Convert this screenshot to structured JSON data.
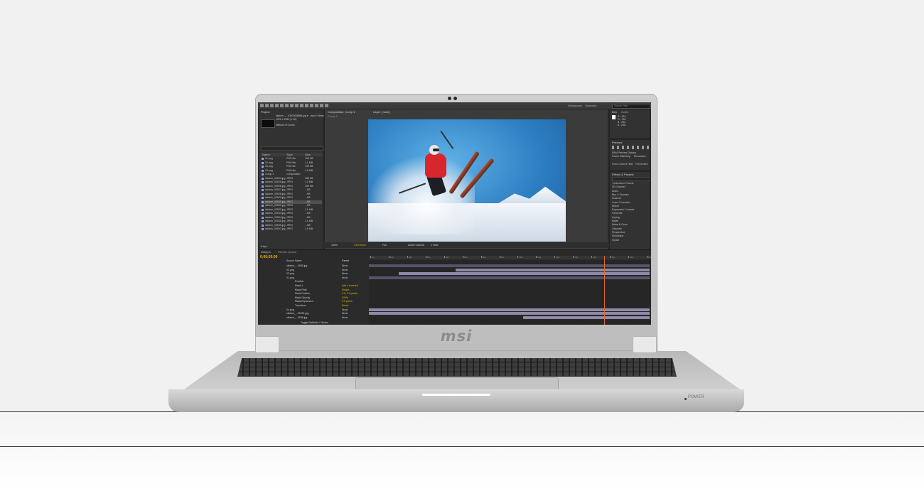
{
  "brand": {
    "logo_text": "msi",
    "power_label": "POWER"
  },
  "app": {
    "toolbar": {
      "workspace": "Workspace",
      "workspace_value": "Standard",
      "search_placeholder": "Search Help"
    },
    "project_panel": {
      "tab": "Project",
      "selected_item": "skier_stunt_00530.jpg",
      "meta_line_1": "skiahm — 100000(8888.jpg ▾ , used 1 time)",
      "meta_line_2": "1920 x 1080 (1.00)",
      "meta_line_3": "Millions of Colors",
      "columns": {
        "name": "Name",
        "type": "Type",
        "size": "Size"
      },
      "items": [
        {
          "name": "01.png",
          "type": "PNG file",
          "size": "765 KB"
        },
        {
          "name": "02.png",
          "type": "PNG file",
          "size": "1.1 MB"
        },
        {
          "name": "03.png",
          "type": "PNG file",
          "size": "735 KB"
        },
        {
          "name": "04.png",
          "type": "PNG file",
          "size": "1.0 MB"
        },
        {
          "name": "Comp 1",
          "type": "Composition",
          "size": ""
        },
        {
          "name": "skiahm_00524.jpg",
          "type": "JPEG",
          "size": "485 KB"
        },
        {
          "name": "skiahm_00525.jpg",
          "type": "JPEG",
          "size": "1.2 MB"
        },
        {
          "name": "skiahm_00526.jpg",
          "type": "JPEG",
          "size": "490 KB"
        },
        {
          "name": "skiahm_00527.jpg",
          "type": "JPEG",
          "size": "...KB"
        },
        {
          "name": "skiahm_00528.jpg",
          "type": "JPEG",
          "size": "...KB"
        },
        {
          "name": "skiahm_00529.jpg",
          "type": "JPEG",
          "size": "...KB"
        },
        {
          "name": "skiahm_00530.jpg",
          "type": "JPEG",
          "size": "...KB"
        },
        {
          "name": "skiahm_00531.jpg",
          "type": "JPEG",
          "size": "...KB"
        },
        {
          "name": "skiahm_00532.jpg",
          "type": "JPEG",
          "size": "1.1 MB"
        },
        {
          "name": "skiahm_00533.jpg",
          "type": "JPEG",
          "size": "...KB"
        },
        {
          "name": "skiahm_00534.jpg",
          "type": "JPEG",
          "size": "...KB"
        },
        {
          "name": "skiahm_00535.jpg",
          "type": "JPEG",
          "size": "1.1 MB"
        },
        {
          "name": "skiahm_00536.jpg",
          "type": "JPEG",
          "size": "...KB"
        },
        {
          "name": "skiahm_00537.jpg",
          "type": "JPEG",
          "size": "1.0 MB"
        }
      ],
      "footer": "8 bpc"
    },
    "composition_panel": {
      "tab_1": "Composition: Comp 1",
      "tab_2": "Layer: (none)",
      "sub_tab": "Comp 1",
      "zoom": "100%",
      "timecode": "0;00;00;00",
      "resolution": "Full",
      "camera": "Active Camera",
      "views": "1 View"
    },
    "right_panels": {
      "info_tab": "Info",
      "audio_tab": "Audio",
      "info_lines": [
        "R : 254",
        "G : 254",
        "B : 254",
        "A : 255"
      ],
      "preview_tab": "Preview",
      "preview_options": "RAM Preview Options",
      "frame_rate": "Frame Rate",
      "skip": "Skip",
      "resolution": "Resolution",
      "from_current": "From Current Time",
      "full_screen": "Full Screen",
      "effects_tab": "Effects & Presets",
      "effects": [
        "* Animation Presets",
        "3D Channel",
        "Audio",
        "Blur & Sharpen",
        "Channel",
        "Color Correction",
        "Distort",
        "Expression Controls",
        "Generate",
        "Keying",
        "Matte",
        "Noise & Grain",
        "Obsolete",
        "Perspective",
        "Simulation",
        "Stylize"
      ]
    },
    "timeline": {
      "tab": "Comp 1",
      "tab_2": "Render Queue",
      "timecode": "0;00;05;00",
      "columns": {
        "source": "Source Name",
        "parent": "Parent"
      },
      "layers": [
        {
          "name": "skiahm_...0530.jpg",
          "parent": "None"
        },
        {
          "name": "03.png",
          "parent": "None"
        },
        {
          "name": "02.png",
          "parent": "None"
        },
        {
          "name": "01.png",
          "parent": "None"
        },
        {
          "name": "Position",
          "parent": ""
        },
        {
          "name": "Mask 1",
          "parent": "Add ▾  Inverted"
        },
        {
          "name": "Mask Path",
          "parent": "Shape..."
        },
        {
          "name": "Mask Feather",
          "parent": "0.0, 0.0 pixels"
        },
        {
          "name": "Mask Opacity",
          "parent": "100%"
        },
        {
          "name": "Mask Expansion",
          "parent": "0.0 pixels"
        },
        {
          "name": "Transform",
          "parent": "Reset"
        },
        {
          "name": "04.png",
          "parent": "None"
        },
        {
          "name": "skiahm_...00531.jpg",
          "parent": "None"
        },
        {
          "name": "skiahm_...0536.jpg",
          "parent": "None"
        }
      ],
      "ruler_labels": [
        "0s",
        "01s",
        "02s",
        "03s",
        "04s",
        "05s",
        "06s",
        "07s",
        "08s",
        "09s",
        "10s",
        "11s",
        "12s",
        "13s",
        "14s",
        "15s"
      ],
      "playhead_seconds": 12.5,
      "duration_seconds": 15,
      "bars": [
        {
          "start": 0,
          "end": 15
        },
        {
          "start": 4.6,
          "end": 15
        },
        {
          "start": 1.6,
          "end": 15
        },
        {
          "start": 0,
          "end": 15
        },
        {
          "start": 0,
          "end": 15
        },
        {
          "start": 0,
          "end": 15
        },
        {
          "start": 0,
          "end": 15
        },
        {
          "start": 0,
          "end": 15
        },
        {
          "start": 0,
          "end": 15
        },
        {
          "start": 0,
          "end": 15
        },
        {
          "start": 8.5,
          "end": 15
        },
        {
          "start": 0,
          "end": 15
        },
        {
          "start": 0,
          "end": 15
        },
        {
          "start": 8.2,
          "end": 15
        }
      ],
      "footer": "Toggle Switches / Modes"
    }
  }
}
